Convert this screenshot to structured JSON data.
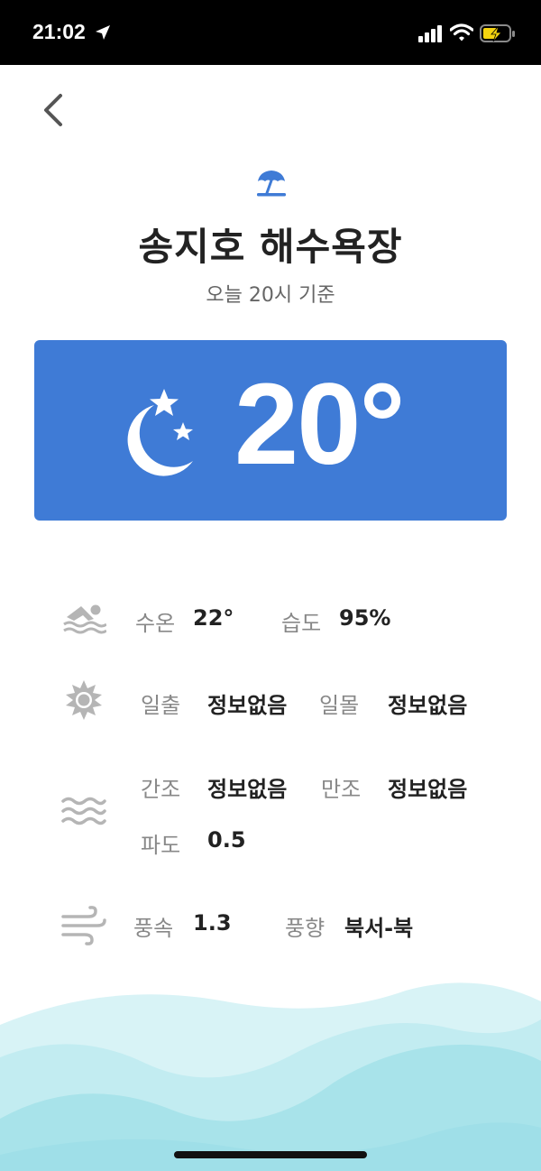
{
  "status_bar": {
    "time": "21:02"
  },
  "header": {
    "title": "송지호 해수욕장",
    "timestamp": "오늘 20시 기준"
  },
  "current": {
    "temperature": "20°",
    "condition_icon": "moon-stars-icon"
  },
  "info": {
    "water_temp_label": "수온",
    "water_temp_value": "22°",
    "humidity_label": "습도",
    "humidity_value": "95%",
    "sunrise_label": "일출",
    "sunrise_value": "정보없음",
    "sunset_label": "일몰",
    "sunset_value": "정보없음",
    "low_tide_label": "간조",
    "low_tide_value": "정보없음",
    "high_tide_label": "만조",
    "high_tide_value": "정보없음",
    "wave_label": "파도",
    "wave_value": "0.5",
    "wind_speed_label": "풍속",
    "wind_speed_value": "1.3",
    "wind_dir_label": "풍향",
    "wind_dir_value": "북서-북"
  },
  "colors": {
    "card": "#3f7bd6",
    "accent": "#3f7bd6",
    "wave_light": "#d6f2f5",
    "wave_mid": "#bfeaf0",
    "wave_dark": "#9fe0e8"
  }
}
